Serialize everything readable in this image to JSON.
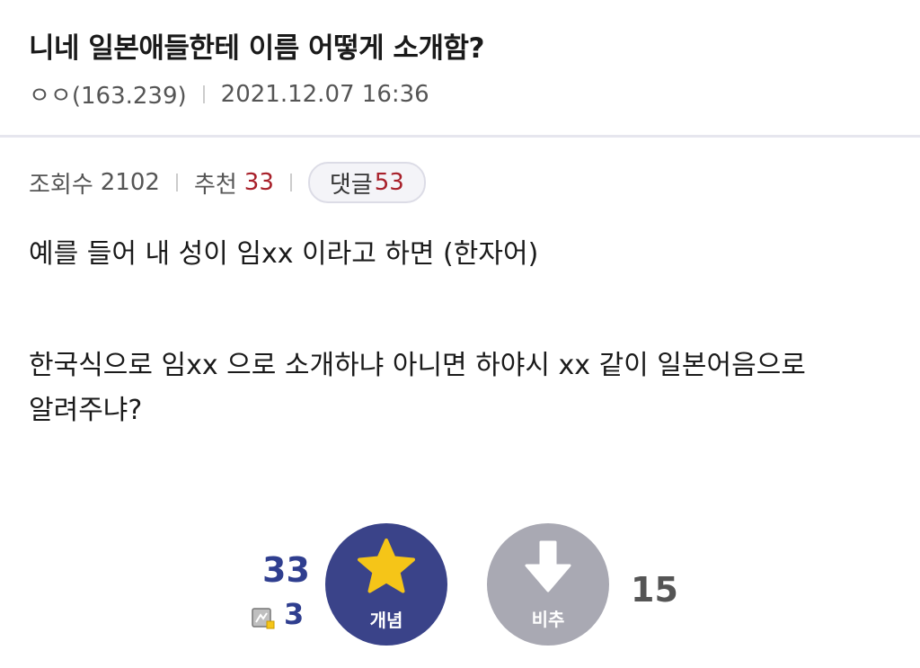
{
  "post": {
    "title": "니네 일본애들한테 이름 어떻게 소개함?",
    "author": "ㅇㅇ(163.239)",
    "date": "2021.12.07 16:36"
  },
  "stats": {
    "views_label": "조회수",
    "views": "2102",
    "recommend_label": "추천",
    "recommend": "33",
    "comments_label": "댓글",
    "comments": "53"
  },
  "body": {
    "line1": "예를 들어 내 성이 임xx 이라고 하면 (한자어)",
    "line2": "한국식으로 임xx 으로 소개하냐 아니면 하야시 xx 같이 일본어음으로",
    "line3": "알려주냐?"
  },
  "votes": {
    "up_count": "33",
    "fix_count": "3",
    "up_label": "개념",
    "down_label": "비추",
    "down_count": "15"
  },
  "colors": {
    "accent_blue": "#3a4389",
    "count_blue": "#2f3e8f",
    "red": "#a8202a",
    "star": "#f5c518",
    "down_gray": "#a9a9b3"
  }
}
